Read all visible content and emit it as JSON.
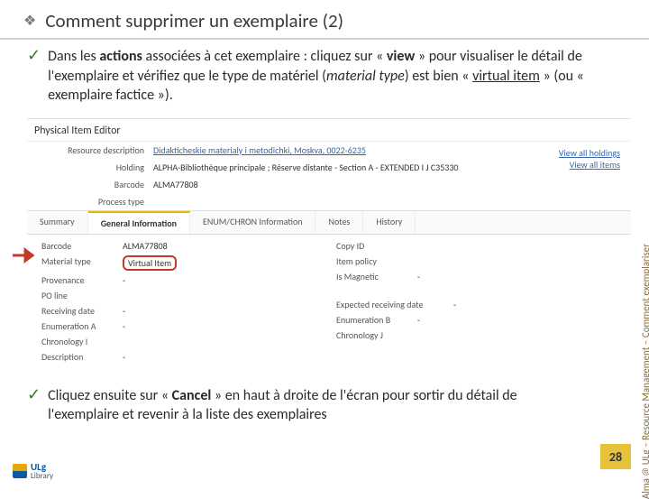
{
  "title": "Comment supprimer un exemplaire (2)",
  "bullet1": {
    "pre": "Dans les ",
    "b1": "actions",
    "mid1": " associées à cet exemplaire : cliquez sur « ",
    "b2": "view",
    "mid2": " » pour visualiser le détail de l'exemplaire et vérifiez que le type de matériel (",
    "i1": "material type",
    "mid3": ") est bien « ",
    "u1": "virtual item",
    "mid4": " » (ou « exemplaire factice »)."
  },
  "screenshot": {
    "editor_title": "Physical Item Editor",
    "rows": {
      "resource_desc_label": "Resource description",
      "resource_desc_value": "Didakticheskie materialy i metodichki, Moskva, 0022-6235",
      "holding_label": "Holding",
      "holding_value": "ALPHA-Bibliothèque principale ; Réserve distante - Section A - EXTENDED I J C35330",
      "barcode_label": "Barcode",
      "barcode_value": "ALMA77808",
      "process_label": "Process type"
    },
    "links": {
      "all_holdings": "View all holdings",
      "all_items": "View all items"
    },
    "tabs": {
      "summary": "Summary",
      "general": "General Information",
      "enum": "ENUM/CHRON Information",
      "notes": "Notes",
      "history": "History"
    },
    "left_fields": {
      "barcode": {
        "l": "Barcode",
        "v": "ALMA77808"
      },
      "material": {
        "l": "Material type",
        "v": "Virtual Item"
      },
      "provenance": {
        "l": "Provenance",
        "v": "-"
      },
      "poline": {
        "l": "PO line",
        "v": ""
      },
      "recvdate": {
        "l": "Receiving date",
        "v": "-"
      },
      "enumA": {
        "l": "Enumeration A",
        "v": "-"
      },
      "chron1": {
        "l": "Chronology I",
        "v": ""
      },
      "desc": {
        "l": "Description",
        "v": "-"
      }
    },
    "right_fields": {
      "copy": {
        "l": "Copy ID",
        "v": ""
      },
      "policy": {
        "l": "Item policy",
        "v": ""
      },
      "magnetic": {
        "l": "Is Magnetic",
        "v": "-"
      },
      "exprecv": {
        "l": "Expected receiving date",
        "v": "-"
      },
      "enumB": {
        "l": "Enumeration B",
        "v": "-"
      },
      "chron2": {
        "l": "Chronology J",
        "v": ""
      }
    }
  },
  "bullet2": {
    "pre": "Cliquez ensuite sur « ",
    "b1": "Cancel",
    "post": " » en haut à droite de l'écran pour sortir du détail de l'exemplaire et revenir à la liste des exemplaires"
  },
  "sidebar": "Alma @ ULg – Resource Management – Comment exemplariser",
  "page_number": "28",
  "logo": {
    "line1": "ULg",
    "line2": "Library"
  }
}
